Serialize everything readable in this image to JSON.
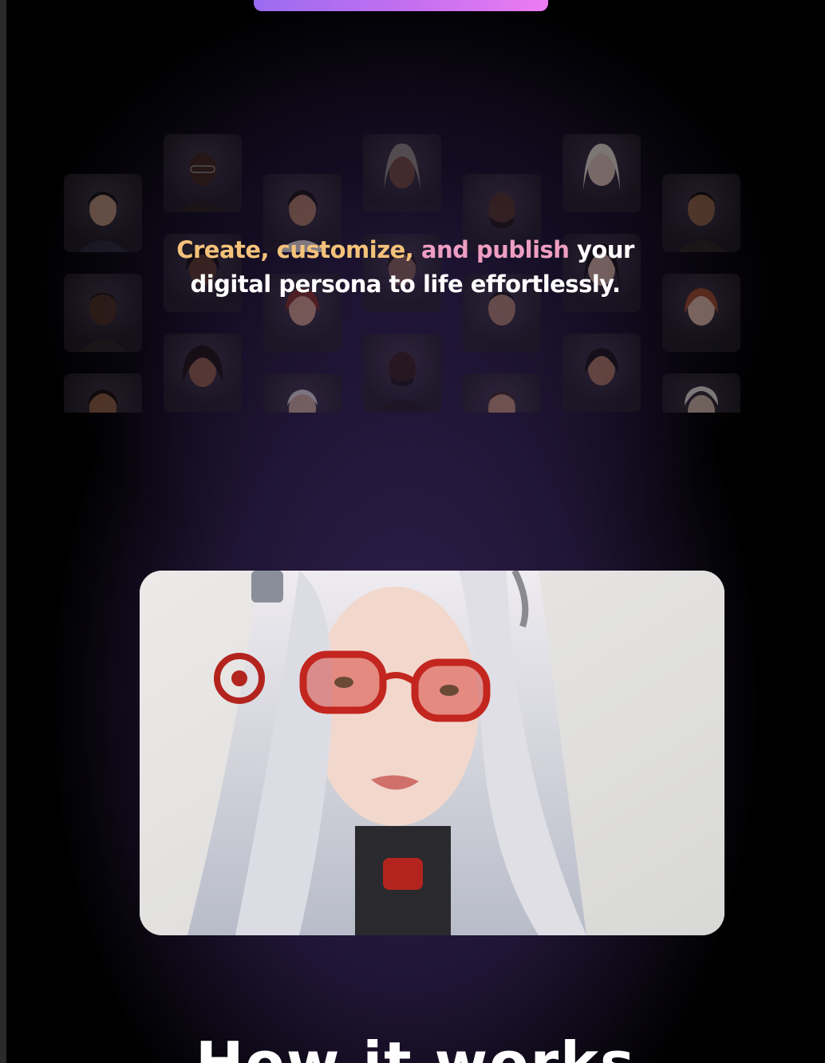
{
  "hero_section": {
    "headline_part1": "Create,",
    "headline_part2": "customize,",
    "headline_part3": "and publish",
    "headline_rest": "your digital persona to life effortlessly."
  },
  "avatar_grid": {
    "count": 24
  },
  "featured_image": {
    "alt": "featured-avatar"
  },
  "next_section": {
    "title": "How it works"
  },
  "colors": {
    "gradient_gold": "#f4c27a",
    "gradient_peach": "#f3aa92",
    "gradient_pink": "#ee9ec2",
    "cta_start": "#9b6cf0",
    "cta_end": "#ec7cf2"
  }
}
